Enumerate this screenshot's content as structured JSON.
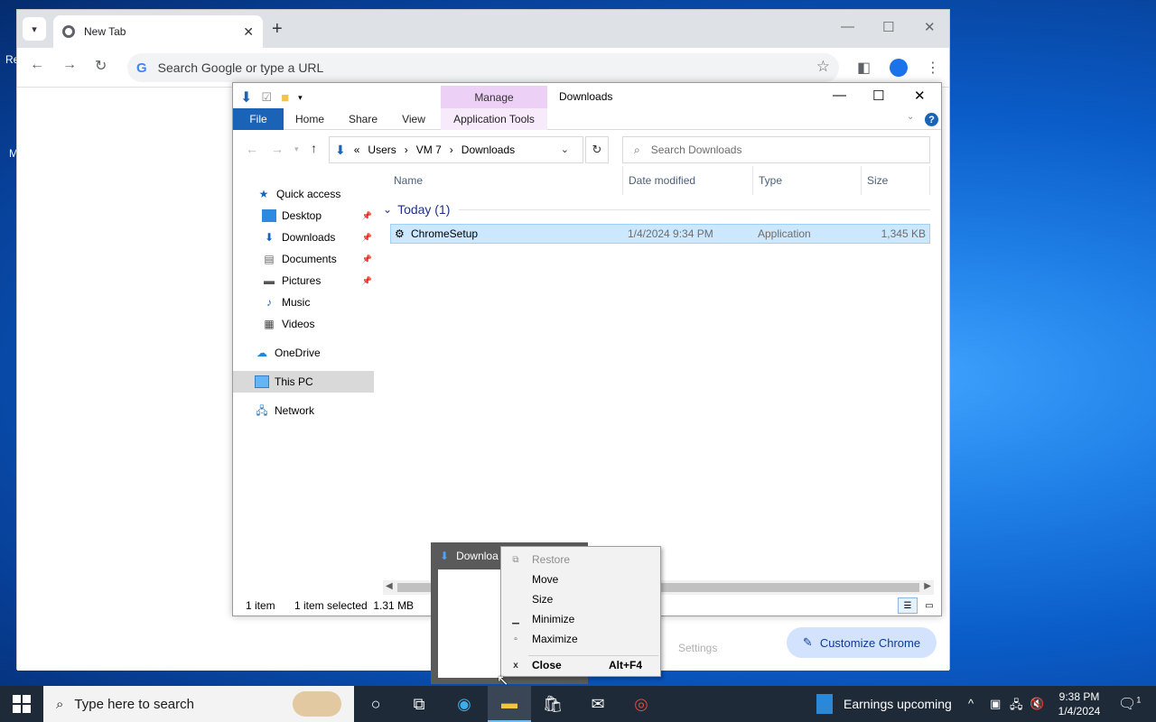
{
  "desktop": {
    "fragments": [
      "Re",
      "M"
    ]
  },
  "chrome": {
    "tab_title": "New Tab",
    "omnibox_placeholder": "Search Google or type a URL",
    "customize_label": "Customize Chrome",
    "settings_label": "Settings"
  },
  "explorer": {
    "window_title": "Downloads",
    "manage_label": "Manage",
    "ribbon_tabs": [
      "File",
      "Home",
      "Share",
      "View",
      "Application Tools"
    ],
    "breadcrumb": [
      "«",
      "Users",
      "›",
      "VM 7",
      "›",
      "Downloads"
    ],
    "search_placeholder": "Search Downloads",
    "columns": [
      "Name",
      "Date modified",
      "Type",
      "Size"
    ],
    "nav": {
      "quick_access": "Quick access",
      "desktop": "Desktop",
      "downloads": "Downloads",
      "documents": "Documents",
      "pictures": "Pictures",
      "music": "Music",
      "videos": "Videos",
      "onedrive": "OneDrive",
      "thispc": "This PC",
      "network": "Network"
    },
    "group_label": "Today (1)",
    "file": {
      "name": "ChromeSetup",
      "date": "1/4/2024 9:34 PM",
      "type": "Application",
      "size": "1,345 KB"
    },
    "status": {
      "count": "1 item",
      "selected": "1 item selected  1.31 MB"
    }
  },
  "thumbnail": {
    "title": "Downloa"
  },
  "context_menu": {
    "restore": "Restore",
    "move": "Move",
    "size": "Size",
    "minimize": "Minimize",
    "maximize": "Maximize",
    "close": "Close",
    "close_accel": "Alt+F4"
  },
  "taskbar": {
    "search_placeholder": "Type here to search",
    "news": "Earnings upcoming",
    "time": "9:38 PM",
    "date": "1/4/2024",
    "notification_count": "1"
  }
}
